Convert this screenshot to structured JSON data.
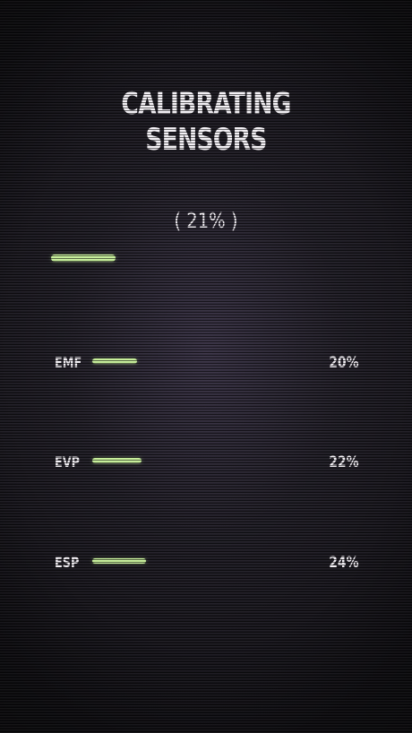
{
  "title": {
    "line1": "CALIBRATING",
    "line2": "SENSORS"
  },
  "overall": {
    "percent_text": "( 21% )",
    "progress": 0.21
  },
  "sensors": [
    {
      "label": "EMF",
      "percent_text": "20%",
      "progress": 0.2
    },
    {
      "label": "EVP",
      "percent_text": "22%",
      "progress": 0.22
    },
    {
      "label": "ESP",
      "percent_text": "24%",
      "progress": 0.24
    }
  ],
  "colors": {
    "bar": "#c6ee9a",
    "text": "#f4f1f6",
    "background": "#1d1b22"
  }
}
